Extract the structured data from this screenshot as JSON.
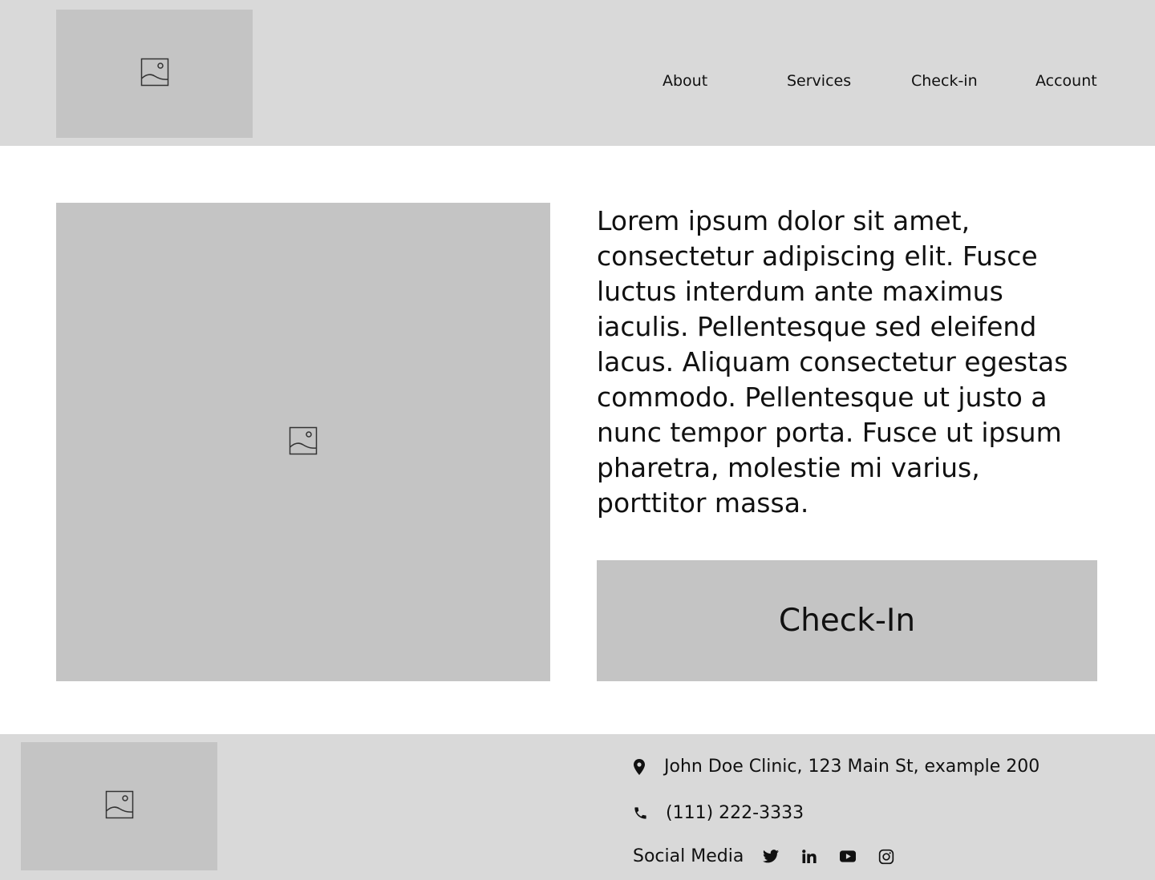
{
  "header": {
    "logo_icon": "image-placeholder-icon",
    "nav": [
      {
        "label": "About"
      },
      {
        "label": "Services"
      },
      {
        "label": "Check-in"
      },
      {
        "label": "Account"
      }
    ]
  },
  "main": {
    "image_icon": "image-placeholder-icon",
    "description": "Lorem ipsum dolor sit amet, consectetur adipiscing elit. Fusce luctus interdum ante maximus iaculis. Pellentesque sed eleifend lacus. Aliquam consectetur egestas commodo. Pellentesque ut justo a nunc tempor porta. Fusce ut ipsum pharetra, molestie mi varius, porttitor massa.",
    "checkin_label": "Check-In"
  },
  "footer": {
    "logo_icon": "image-placeholder-icon",
    "address": "John Doe Clinic, 123 Main St, example 200",
    "phone": "(111) 222-3333",
    "social_label": "Social Media",
    "social_icons": [
      "twitter-icon",
      "linkedin-icon",
      "youtube-icon",
      "instagram-icon"
    ]
  },
  "colors": {
    "header_bg": "#d9d9d9",
    "placeholder_bg": "#c4c4c4",
    "page_bg": "#ffffff",
    "text": "#111111"
  }
}
